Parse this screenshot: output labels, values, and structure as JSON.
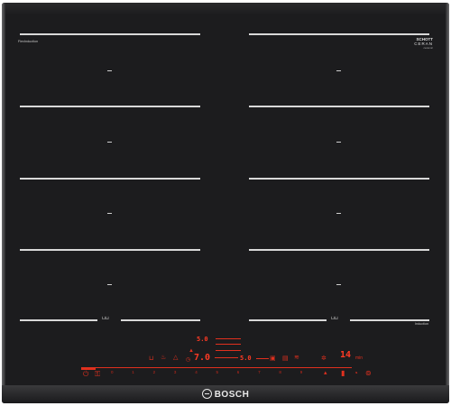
{
  "panel": {
    "left_tag": "FlexInduction",
    "brand_top": "SCHOTT",
    "brand_bottom": "CERAN",
    "brand_sub": "ceramic",
    "flex_icon_left": "⊔⊔",
    "flex_icon_right": "⊔⊔",
    "induction_label": "Induction",
    "logo": "BOSCH",
    "logo_icon": "bosch-armature-icon"
  },
  "controls": {
    "timer_value": "14",
    "power_value": "7.0",
    "display_left": "5.0",
    "display_right": "5.0",
    "scale": [
      "0",
      "1",
      "2",
      "3",
      "4",
      "5",
      "6",
      "7",
      "8",
      "9"
    ],
    "power_icon": "power-icon",
    "lock_icon": "child-lock-icon",
    "accent_color": "#e0301e"
  }
}
